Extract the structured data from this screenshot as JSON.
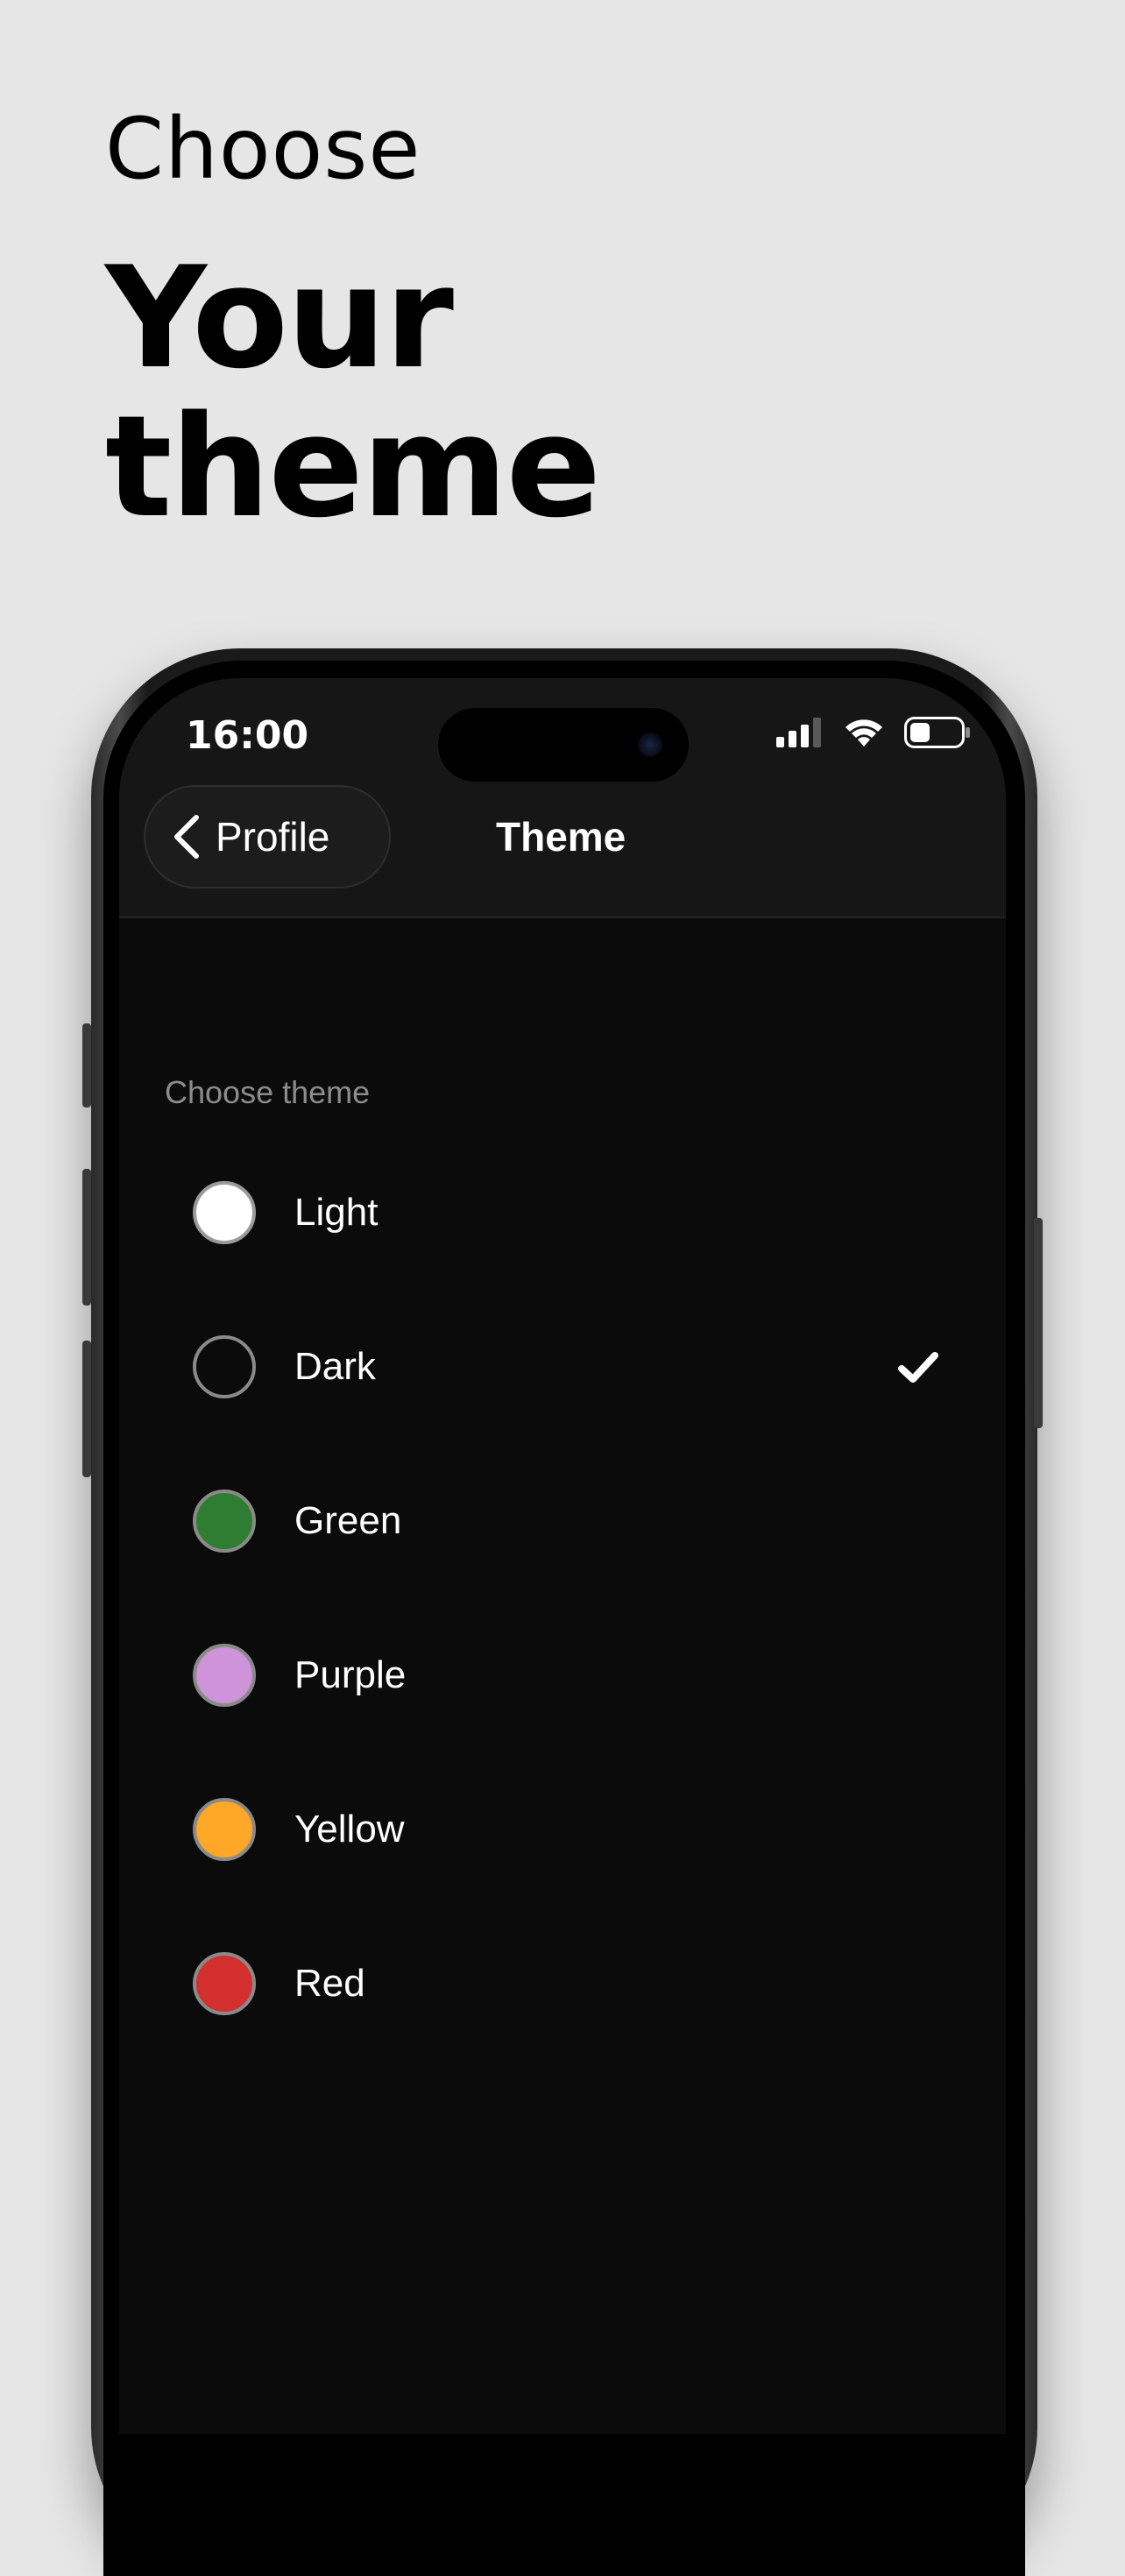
{
  "promo": {
    "pre_title": "Choose",
    "title": "Your theme"
  },
  "status_bar": {
    "time": "16:00"
  },
  "nav": {
    "back_label": "Profile",
    "title": "Theme"
  },
  "section_label": "Choose theme",
  "selected_theme": "Dark",
  "themes": [
    {
      "label": "Light",
      "color": "#ffffff",
      "border": "#9a9a9a"
    },
    {
      "label": "Dark",
      "color": "#0b0b0b",
      "border": "#8a8a8a"
    },
    {
      "label": "Green",
      "color": "#2e7d32",
      "border": "#8a8a8a"
    },
    {
      "label": "Purple",
      "color": "#ce93d8",
      "border": "#8a8a8a"
    },
    {
      "label": "Yellow",
      "color": "#ffa726",
      "border": "#8a8a8a"
    },
    {
      "label": "Red",
      "color": "#d32f2f",
      "border": "#8a8a8a"
    }
  ],
  "colors": {
    "page_background": "#e6e6e6",
    "screen_background": "#0b0b0b",
    "header_background": "#161616",
    "text_primary": "#ffffff",
    "text_secondary": "#8c8c8c"
  },
  "icons": {
    "back": "chevron-left-icon",
    "check": "checkmark-icon",
    "signal": "cellular-signal-icon",
    "wifi": "wifi-icon",
    "battery": "battery-icon"
  }
}
